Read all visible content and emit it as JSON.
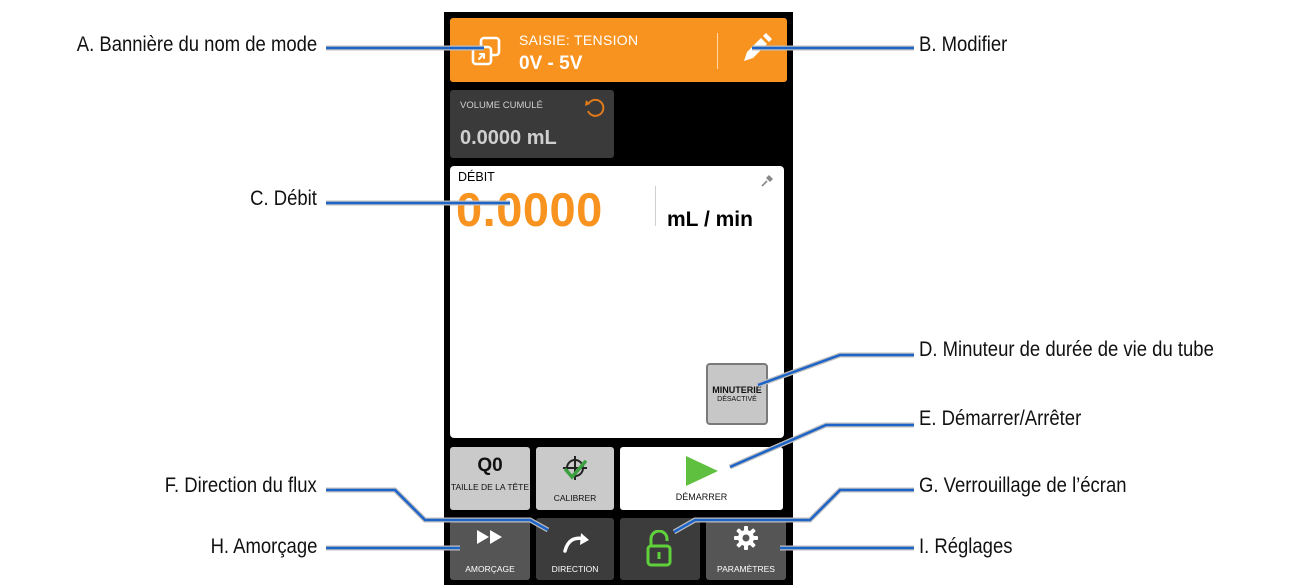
{
  "callouts": {
    "a": "A. Bannière du nom de mode",
    "b": "B. Modifier",
    "c": "C. Débit",
    "d": "D. Minuteur de durée de vie du tube",
    "e": "E. Démarrer/Arrêter",
    "f": "F. Direction du flux",
    "g": "G. Verrouillage de l’écran",
    "h": "H. Amorçage",
    "i": "I. Réglages"
  },
  "banner": {
    "mode_label": "SAISIE: TENSION",
    "mode_value": "0V - 5V",
    "color": "#f7931e"
  },
  "volume": {
    "label": "VOLUME CUMULÉ",
    "value": "0.0000 mL"
  },
  "flow": {
    "label": "DÉBIT",
    "value": "0.0000",
    "unit": "mL / min",
    "timer_line1": "MINUTERIE",
    "timer_line2": "DÉSACTIVÉ"
  },
  "buttons": {
    "head_size_value": "Q0",
    "head_size_label": "TAILLE DE LA TÊTE",
    "calibrate_label": "CALIBRER",
    "start_label": "DÉMARRER",
    "prime_label": "AMORÇAGE",
    "direction_label": "DIRECTION",
    "settings_label": "PARAMÈTRES"
  },
  "colors": {
    "accent": "#f7931e",
    "leader": "#1d64c8",
    "start_green": "#5fbf3f",
    "lock_green": "#5fd13a"
  },
  "icons": [
    "mode-icon",
    "pencil-icon",
    "reset-icon",
    "pin-icon",
    "crosshair-check-icon",
    "play-icon",
    "fast-forward-icon",
    "curved-arrow-icon",
    "unlock-icon",
    "gear-icon"
  ]
}
